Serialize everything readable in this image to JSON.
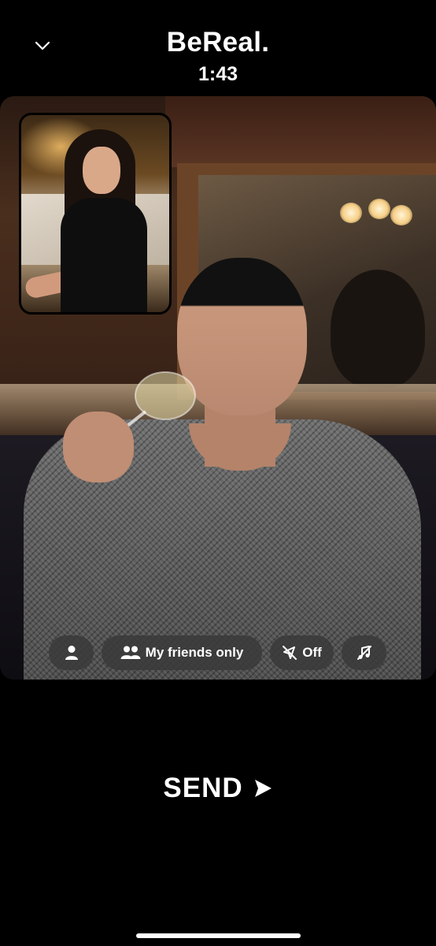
{
  "header": {
    "title": "BeReal.",
    "timer": "1:43",
    "collapse_icon": "chevron-down-icon"
  },
  "photo": {
    "main_description": "",
    "inset_description": ""
  },
  "options": {
    "audience_icon": "person-icon",
    "friends_icon": "people-icon",
    "friends_label": "My friends only",
    "location_icon": "location-off-icon",
    "location_label": "Off",
    "music_icon": "music-off-icon"
  },
  "send": {
    "label": "SEND",
    "icon": "send-arrow-icon"
  },
  "colors": {
    "background": "#000000",
    "text": "#ffffff",
    "pill_background": "#3a3a3a"
  }
}
